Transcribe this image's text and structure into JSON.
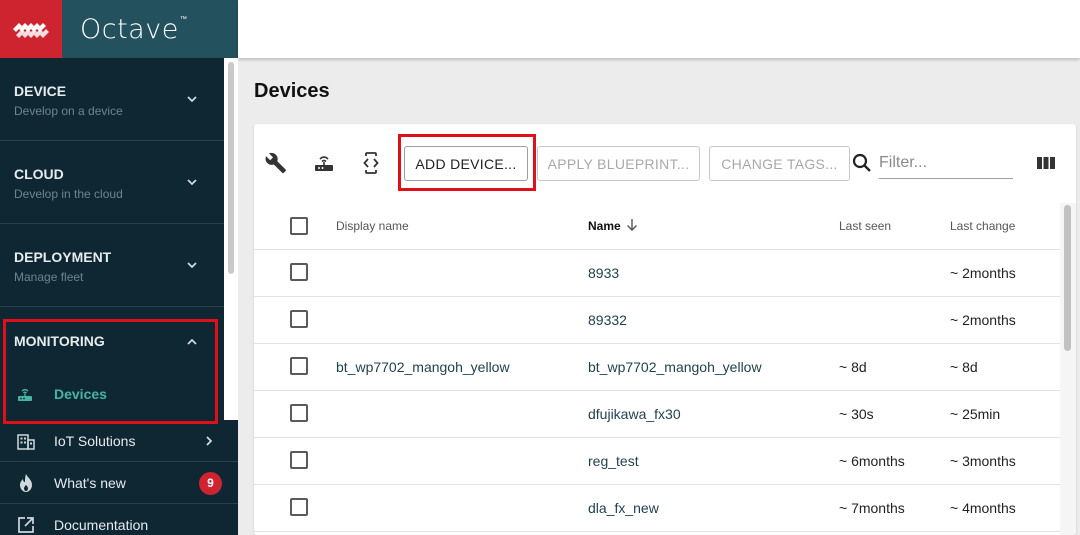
{
  "app": {
    "brand": "Octave",
    "trademark": "™"
  },
  "sidebar": {
    "sections": [
      {
        "title": "DEVICE",
        "subtitle": "Develop on a device"
      },
      {
        "title": "CLOUD",
        "subtitle": "Develop in the cloud"
      },
      {
        "title": "DEPLOYMENT",
        "subtitle": "Manage fleet"
      }
    ],
    "monitoring": {
      "title": "MONITORING",
      "active_item": "Devices"
    },
    "items": [
      {
        "label": "IoT Solutions"
      },
      {
        "label": "What's new",
        "badge": "9"
      },
      {
        "label": "Documentation"
      }
    ]
  },
  "main": {
    "title": "Devices",
    "toolbar": {
      "add_device": "ADD DEVICE...",
      "apply_blueprint": "APPLY BLUEPRINT...",
      "change_tags": "CHANGE TAGS...",
      "filter_placeholder": "Filter..."
    },
    "table": {
      "headers": {
        "display_name": "Display name",
        "name": "Name",
        "last_seen": "Last seen",
        "last_change": "Last change"
      },
      "rows": [
        {
          "display_name": "",
          "name": "8933",
          "last_seen": "",
          "last_change": "~ 2months"
        },
        {
          "display_name": "",
          "name": "89332",
          "last_seen": "",
          "last_change": "~ 2months"
        },
        {
          "display_name": "bt_wp7702_mangoh_yellow",
          "name": "bt_wp7702_mangoh_yellow",
          "last_seen": "~ 8d",
          "last_change": "~ 8d"
        },
        {
          "display_name": "",
          "name": "dfujikawa_fx30",
          "last_seen": "~ 30s",
          "last_change": "~ 25min"
        },
        {
          "display_name": "",
          "name": "reg_test",
          "last_seen": "~ 6months",
          "last_change": "~ 3months"
        },
        {
          "display_name": "",
          "name": "dla_fx_new",
          "last_seen": "~ 7months",
          "last_change": "~ 4months"
        }
      ]
    }
  },
  "colors": {
    "brand_red": "#cd2430",
    "brand_teal": "#24515e",
    "sidebar_bg": "#0f2733",
    "accent_teal": "#48b4a4",
    "highlight_red": "#e0101a"
  }
}
